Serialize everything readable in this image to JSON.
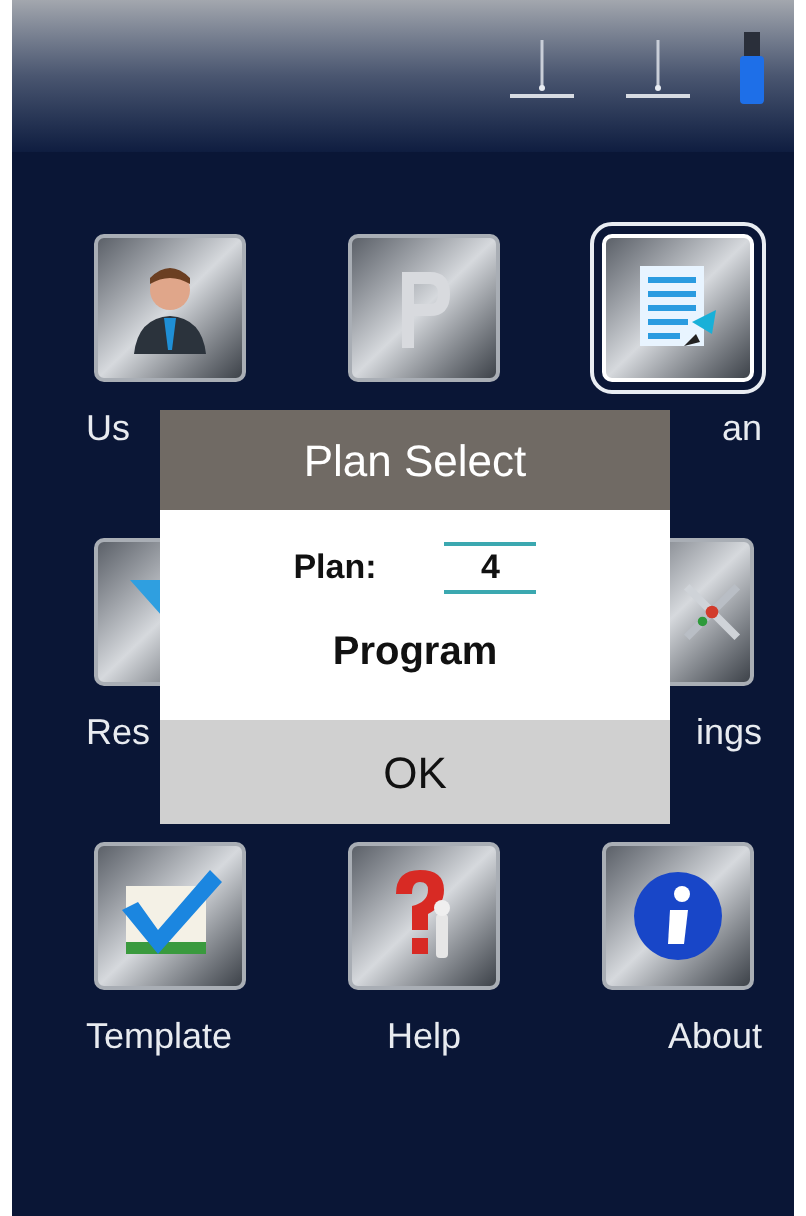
{
  "status_icons": [
    {
      "kind": "antenna"
    },
    {
      "kind": "antenna"
    },
    {
      "kind": "usb"
    }
  ],
  "menu_rows": [
    [
      {
        "kind": "user",
        "label": "Us",
        "selected": false
      },
      {
        "kind": "letter_p",
        "selected": false
      },
      {
        "kind": "document",
        "label": "an",
        "selected": true
      }
    ],
    [
      {
        "kind": "funnel",
        "label": "Res",
        "selected": false
      },
      {
        "kind": "tools",
        "label": "ings",
        "selected": false
      }
    ],
    [
      {
        "kind": "check",
        "label": "Template",
        "selected": false
      },
      {
        "kind": "help",
        "label": "Help",
        "selected": false
      },
      {
        "kind": "info",
        "label": "About",
        "selected": false
      }
    ]
  ],
  "dialog": {
    "title": "Plan Select",
    "field_label": "Plan:",
    "field_value": "4",
    "program": "Program",
    "button": "OK"
  }
}
